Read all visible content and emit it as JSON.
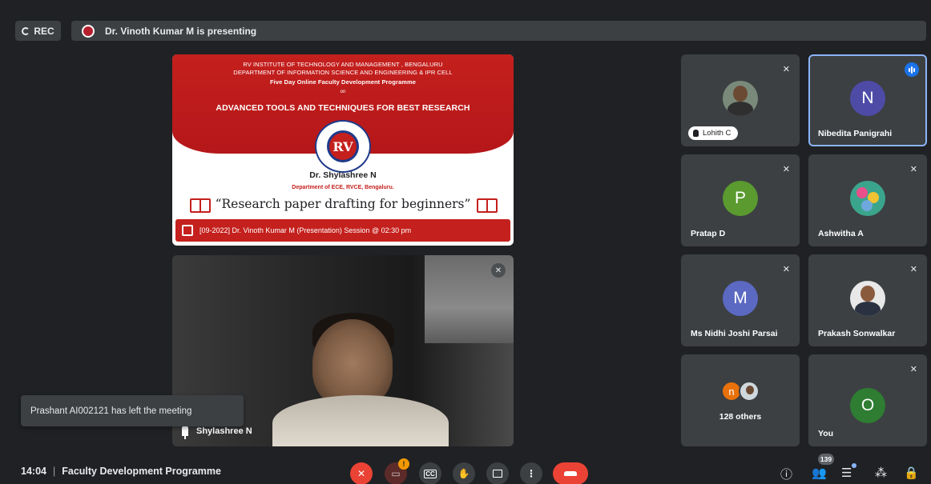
{
  "topbar": {
    "rec_label": "REC",
    "presenting_text": "Dr. Vinoth Kumar M is presenting"
  },
  "slide": {
    "institute": "RV INSTITUTE OF TECHNOLOGY AND MANAGEMENT , BENGALURU",
    "department": "DEPARTMENT OF INFORMATION SCIENCE AND ENGINEERING & IPR CELL",
    "programme": "Five Day Online Faculty Development Programme",
    "on": "on",
    "theme": "ADVANCED TOOLS AND TECHNIQUES FOR BEST RESEARCH",
    "emblem_text": "RV",
    "speaker": "Dr. Shylashree N",
    "speaker_dept": "Department of ECE, RVCE, Bengaluru.",
    "talk_title": "“Research paper drafting for beginners”",
    "bottom_text": "[09-2022]   Dr. Vinoth Kumar M (Presentation)   Session @ 02:30 pm"
  },
  "main_camera": {
    "name": "Shylashree N"
  },
  "toast": {
    "message": "Prashant AI002121 has left the meeting"
  },
  "participants": [
    {
      "name": "Lohith C",
      "type": "photo",
      "muted": true,
      "hand_raised": true
    },
    {
      "name": "Nibedita Panigrahi",
      "type": "avatar",
      "initial": "N",
      "color": "#4e4ba7",
      "speaking": true
    },
    {
      "name": "Pratap D",
      "type": "avatar",
      "initial": "P",
      "color": "#5a9a2f",
      "muted": true
    },
    {
      "name": "Ashwitha A",
      "type": "photo",
      "muted": true
    },
    {
      "name": "Ms Nidhi Joshi Parsai",
      "type": "avatar",
      "initial": "M",
      "color": "#5b69c2",
      "muted": true
    },
    {
      "name": "Prakash Sonwalkar",
      "type": "photo",
      "muted": true
    },
    {
      "label": "128 others",
      "initial": "n",
      "color": "#e8710a"
    },
    {
      "name": "You",
      "type": "avatar",
      "initial": "O",
      "color": "#2e7d32",
      "muted": true
    }
  ],
  "bottom": {
    "time": "14:04",
    "meeting_title": "Faculty Development Programme",
    "camera_badge": "!",
    "people_count": "139"
  },
  "colors": {
    "background": "#202124",
    "tile": "#3c4043",
    "hangup": "#ea4335",
    "active_border": "#8ab4f8"
  }
}
